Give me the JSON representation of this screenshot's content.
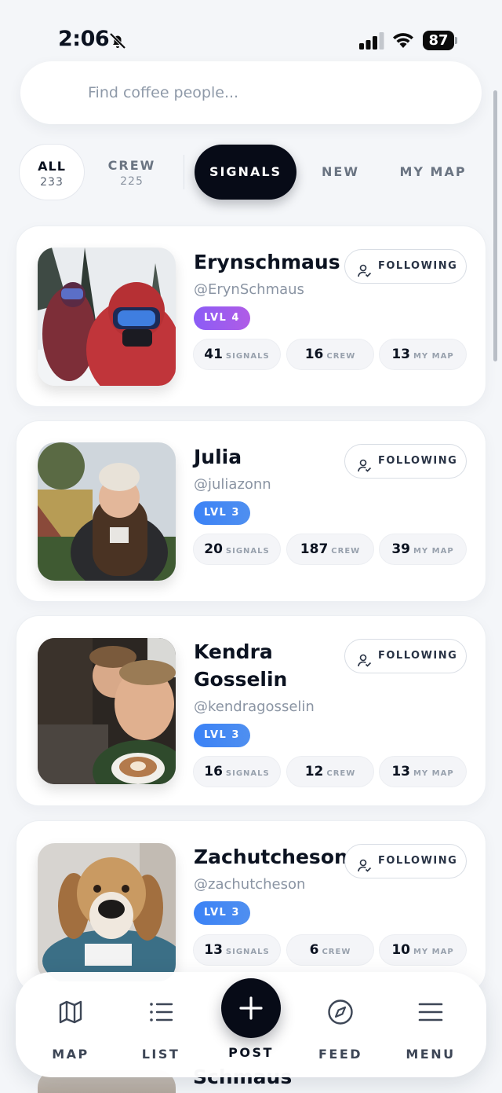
{
  "status": {
    "time": "2:06",
    "battery": "87"
  },
  "search": {
    "placeholder": "Find coffee people..."
  },
  "tabs": {
    "all": {
      "label": "ALL",
      "count": "233"
    },
    "crew": {
      "label": "CREW",
      "count": "225"
    },
    "signals": {
      "label": "SIGNALS"
    },
    "new": {
      "label": "NEW"
    },
    "my_map": {
      "label": "MY MAP"
    }
  },
  "follow_label": "FOLLOWING",
  "stat_units": {
    "signals": "SIGNALS",
    "crew": "CREW",
    "my_map": "MY MAP"
  },
  "people": [
    {
      "name": "Erynschmaus",
      "handle": "@ErynSchmaus",
      "level": "LVL 4",
      "signals": "41",
      "crew": "16",
      "my_map": "13"
    },
    {
      "name": "Julia",
      "handle": "@juliazonn",
      "level": "LVL 3",
      "signals": "20",
      "crew": "187",
      "my_map": "39"
    },
    {
      "name": "Kendra Gosselin",
      "handle": "@kendragosselin",
      "level": "LVL 3",
      "signals": "16",
      "crew": "12",
      "my_map": "13"
    },
    {
      "name": "Zachutcheson",
      "handle": "@zachutcheson",
      "level": "LVL 3",
      "signals": "13",
      "crew": "6",
      "my_map": "10"
    }
  ],
  "peek": {
    "name": "Schmaus"
  },
  "nav": {
    "map": "MAP",
    "list": "LIST",
    "post": "POST",
    "feed": "FEED",
    "menu": "MENU"
  },
  "colors": {
    "accent_dark": "#070b17",
    "level_purple": "#8b5cf6",
    "level_blue": "#3b82f6"
  }
}
